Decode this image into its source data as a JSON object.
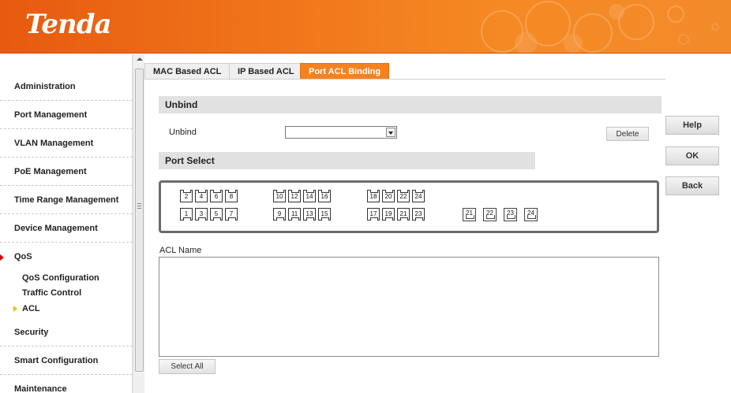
{
  "brand": {
    "logo": "Tenda",
    "header_color": "#f27a1c",
    "accent": "#f5821f"
  },
  "sidebar": {
    "items": [
      {
        "label": "Administration"
      },
      {
        "label": "Port Management"
      },
      {
        "label": "VLAN Management"
      },
      {
        "label": "PoE Management"
      },
      {
        "label": "Time Range Management"
      },
      {
        "label": "Device Management"
      },
      {
        "label": "QoS"
      },
      {
        "label": "Security"
      },
      {
        "label": "Smart Configuration"
      },
      {
        "label": "Maintenance"
      }
    ],
    "qos_sub": [
      {
        "label": "QoS Configuration"
      },
      {
        "label": "Traffic Control"
      },
      {
        "label": "ACL"
      }
    ]
  },
  "tabs": [
    {
      "label": "MAC Based ACL"
    },
    {
      "label": "IP Based ACL"
    },
    {
      "label": "Port ACL Binding",
      "active": true
    }
  ],
  "unbind": {
    "section_title": "Unbind",
    "field_label": "Unbind",
    "select_value": "",
    "delete_label": "Delete"
  },
  "port_select": {
    "section_title": "Port Select",
    "top_row": [
      "2",
      "4",
      "6",
      "8",
      "10",
      "12",
      "14",
      "16",
      "18",
      "20",
      "22",
      "24"
    ],
    "bottom_row": [
      "1",
      "3",
      "5",
      "7",
      "9",
      "11",
      "13",
      "15",
      "17",
      "19",
      "21",
      "23"
    ],
    "sfp": [
      "21",
      "22",
      "23",
      "24"
    ]
  },
  "acl": {
    "label": "ACL Name",
    "select_all_label": "Select All"
  },
  "actions": {
    "help": "Help",
    "ok": "OK",
    "back": "Back"
  }
}
